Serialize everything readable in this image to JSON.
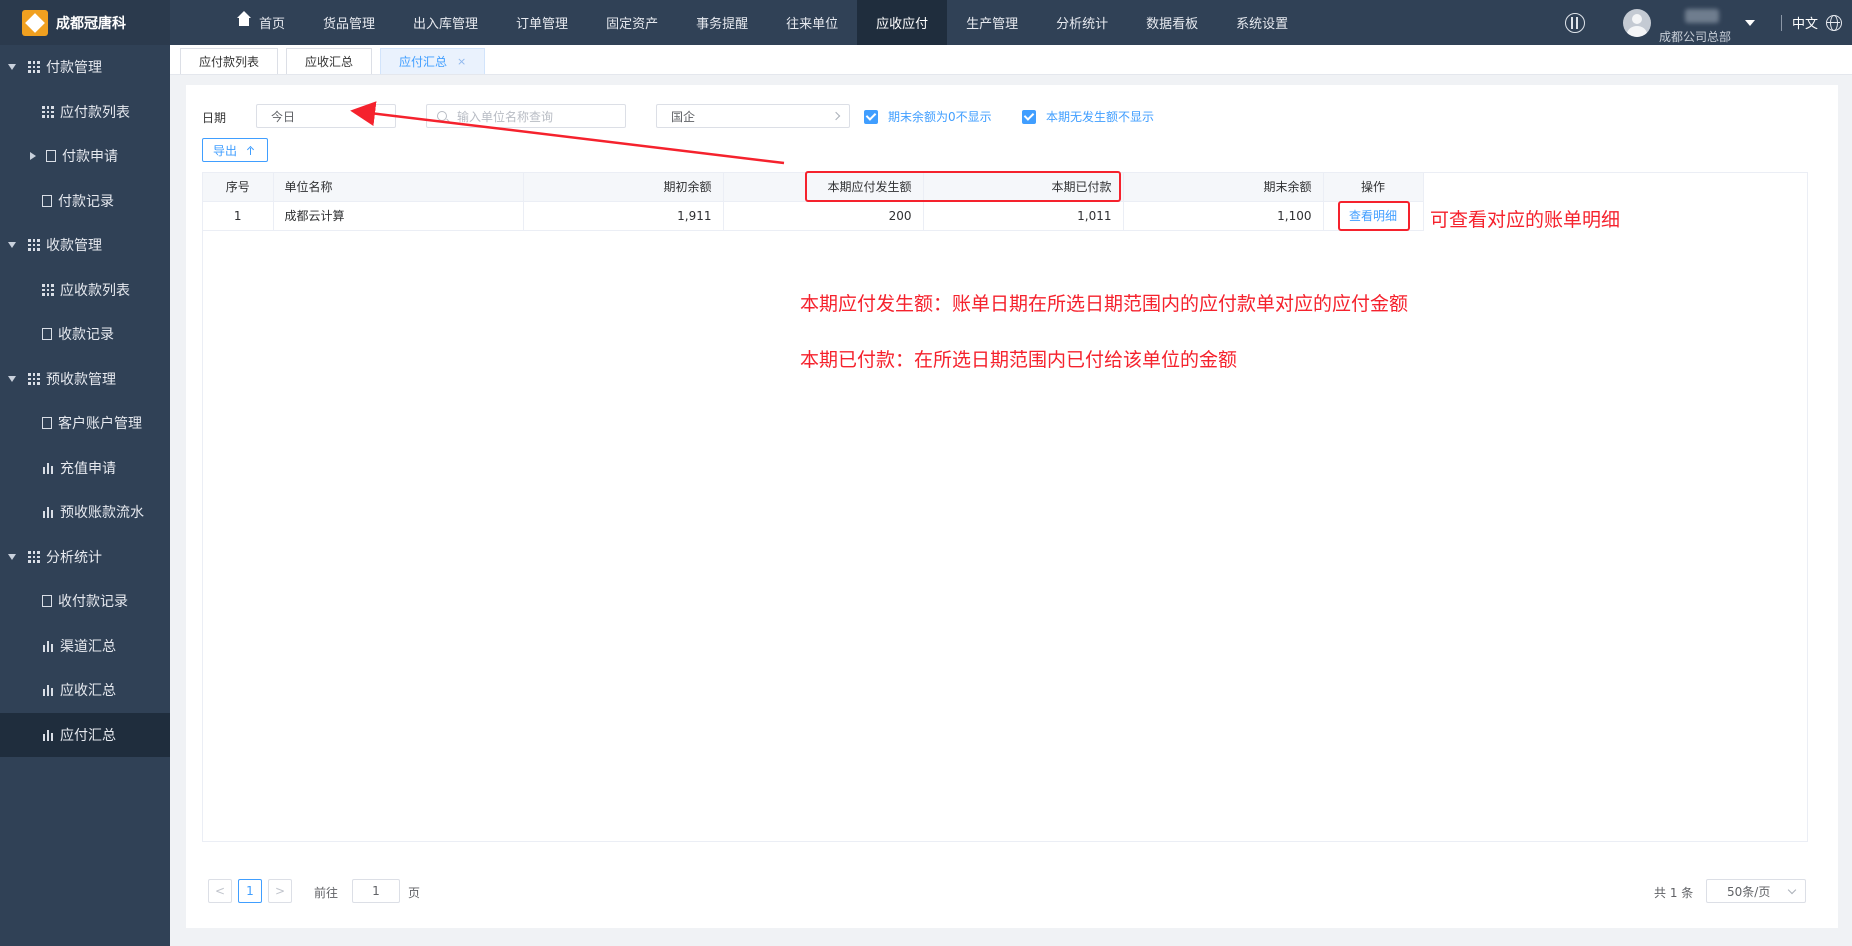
{
  "app": {
    "title": "成都冠唐科"
  },
  "sidebar": {
    "items": [
      {
        "label": "付款管理",
        "level": "group",
        "icon": "grid-icon",
        "expanded": true
      },
      {
        "label": "应付款列表",
        "level": "sub",
        "icon": "grid-icon"
      },
      {
        "label": "付款申请",
        "level": "sub",
        "icon": "document-icon",
        "collapsed_parent": true
      },
      {
        "label": "付款记录",
        "level": "sub",
        "icon": "document-icon"
      },
      {
        "label": "收款管理",
        "level": "group",
        "icon": "grid-icon",
        "expanded": true
      },
      {
        "label": "应收款列表",
        "level": "sub",
        "icon": "grid-icon"
      },
      {
        "label": "收款记录",
        "level": "sub",
        "icon": "document-icon"
      },
      {
        "label": "预收款管理",
        "level": "group",
        "icon": "grid-icon",
        "expanded": true
      },
      {
        "label": "客户账户管理",
        "level": "sub",
        "icon": "document-icon"
      },
      {
        "label": "充值申请",
        "level": "sub",
        "icon": "bar-chart-icon"
      },
      {
        "label": "预收账款流水",
        "level": "sub",
        "icon": "bar-chart-icon"
      },
      {
        "label": "分析统计",
        "level": "group",
        "icon": "grid-icon",
        "expanded": true
      },
      {
        "label": "收付款记录",
        "level": "sub",
        "icon": "document-icon"
      },
      {
        "label": "渠道汇总",
        "level": "sub",
        "icon": "bar-chart-icon"
      },
      {
        "label": "应收汇总",
        "level": "sub",
        "icon": "bar-chart-icon"
      },
      {
        "label": "应付汇总",
        "level": "sub",
        "icon": "bar-chart-icon",
        "active": true
      }
    ]
  },
  "topnav": {
    "items": [
      "首页",
      "货品管理",
      "出入库管理",
      "订单管理",
      "固定资产",
      "事务提醒",
      "往来单位",
      "应收应付",
      "生产管理",
      "分析统计",
      "数据看板",
      "系统设置"
    ],
    "active": "应收应付",
    "user_org": "成都公司总部",
    "language": "中文"
  },
  "tabs": [
    {
      "label": "应付款列表"
    },
    {
      "label": "应收汇总"
    },
    {
      "label": "应付汇总",
      "active": true,
      "close": "×"
    }
  ],
  "filters": {
    "date_label": "日期",
    "date_value": "今日",
    "search_placeholder": "输入单位名称查询",
    "org_value": "国企",
    "checkbox1": "期末余额为0不显示",
    "checkbox2": "本期无发生额不显示"
  },
  "toolbar": {
    "export_label": "导出"
  },
  "table": {
    "columns": [
      "序号",
      "单位名称",
      "期初余额",
      "本期应付发生额",
      "本期已付款",
      "期末余额",
      "操作"
    ],
    "rows": [
      {
        "index": "1",
        "name": "成都云计算",
        "opening": "1,911",
        "payable": "200",
        "paid": "1,011",
        "closing": "1,100",
        "action": "查看明细"
      }
    ]
  },
  "pager": {
    "prev": "<",
    "current": "1",
    "next": ">",
    "goto_prefix": "前往",
    "goto_value": "1",
    "goto_suffix": "页",
    "total": "共 1 条",
    "page_size": "50条/页"
  },
  "annotations": {
    "note1": "可查看对应的账单明细",
    "note2": "本期应付发生额：账单日期在所选日期范围内的应付款单对应的应付金额",
    "note3": "本期已付款：在所选日期范围内已付给该单位的金额"
  },
  "colors": {
    "accent": "#409eff",
    "sidebar": "#304156",
    "annotation": "#f5222d"
  }
}
